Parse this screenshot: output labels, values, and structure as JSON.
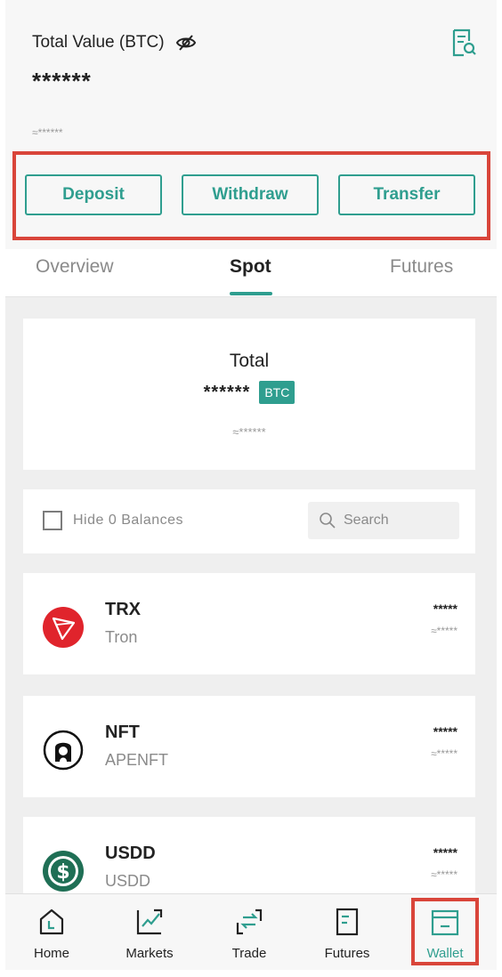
{
  "header": {
    "total_value_label": "Total Value (BTC)",
    "total_value_masked": "******",
    "approx_value": "≈******",
    "eye_icon": "eye-off-icon",
    "report_icon": "report-search-icon"
  },
  "actions": {
    "deposit": "Deposit",
    "withdraw": "Withdraw",
    "transfer": "Transfer"
  },
  "tabs": [
    {
      "label": "Overview",
      "active": false
    },
    {
      "label": "Spot",
      "active": true
    },
    {
      "label": "Futures",
      "active": false
    }
  ],
  "total_card": {
    "title": "Total",
    "masked": "******",
    "currency": "BTC",
    "approx": "≈******"
  },
  "filter": {
    "hide_zero_label": "Hide 0 Balances",
    "hide_zero_checked": false,
    "search_placeholder": "Search"
  },
  "assets": [
    {
      "symbol": "TRX",
      "name": "Tron",
      "amount": "*****",
      "approx": "≈*****",
      "icon": "tron-icon"
    },
    {
      "symbol": "NFT",
      "name": "APENFT",
      "amount": "*****",
      "approx": "≈*****",
      "icon": "apenft-icon"
    },
    {
      "symbol": "USDD",
      "name": "USDD",
      "amount": "*****",
      "approx": "≈*****",
      "icon": "usdd-icon"
    }
  ],
  "bottom_nav": [
    {
      "label": "Home",
      "icon": "home-icon",
      "active": false
    },
    {
      "label": "Markets",
      "icon": "markets-icon",
      "active": false
    },
    {
      "label": "Trade",
      "icon": "trade-icon",
      "active": false
    },
    {
      "label": "Futures",
      "icon": "futures-icon",
      "active": false
    },
    {
      "label": "Wallet",
      "icon": "wallet-icon",
      "active": true
    }
  ],
  "colors": {
    "accent": "#2f9e8f",
    "highlight": "#d9453a",
    "tron": "#e0242c"
  }
}
